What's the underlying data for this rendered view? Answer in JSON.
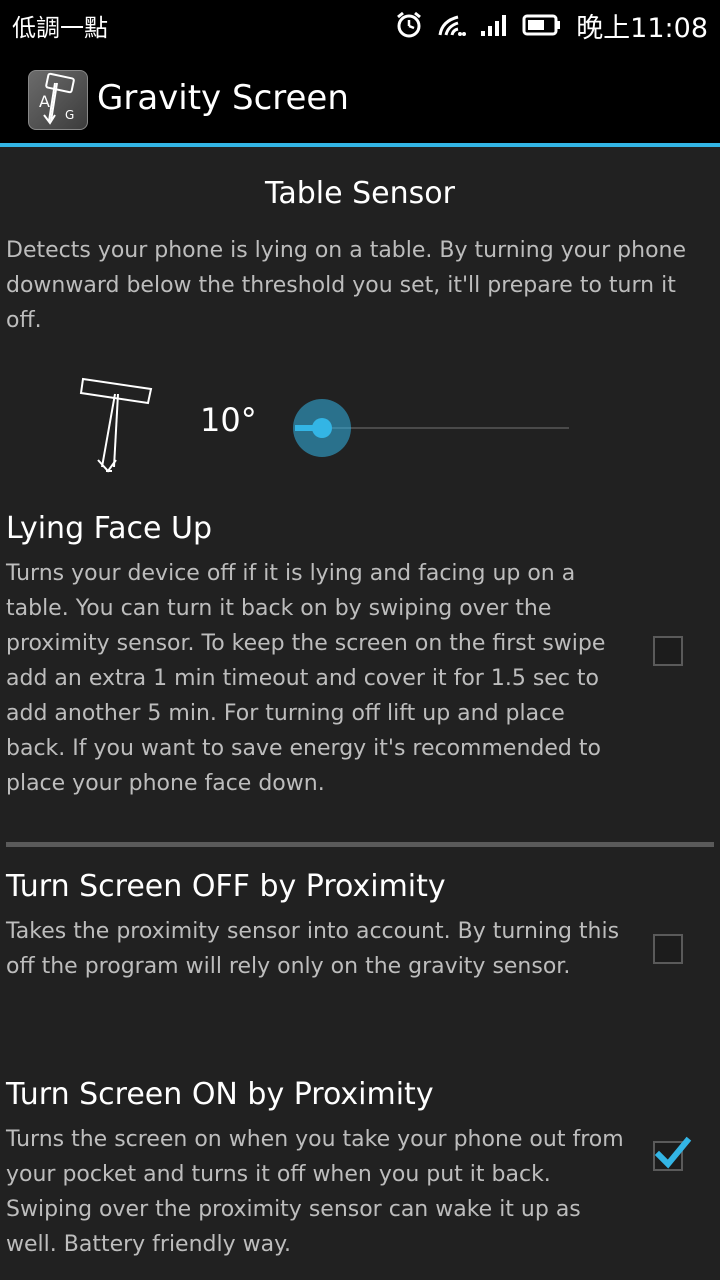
{
  "status_bar": {
    "carrier_text": "低調一點",
    "time": "晚上11:08",
    "icons": [
      "alarm-icon",
      "wifi-icon",
      "signal-icon",
      "battery-icon"
    ]
  },
  "action_bar": {
    "title": "Gravity Screen",
    "icon": "app-icon",
    "icon_letters": "AG"
  },
  "table_sensor": {
    "title": "Table Sensor",
    "description": "Detects your phone is lying on a table. By turning your phone downward below the threshold you set, it'll prepare to turn it off.",
    "angle_label": "10°",
    "slider_fraction": 0.1
  },
  "preferences": [
    {
      "title": "Lying Face Up",
      "summary": "Turns your device off if it is lying and facing up on a table. You can turn it back on by swiping over the proximity sensor. To keep the screen on the first swipe add an extra 1 min timeout and cover it for 1.5 sec to add another 5 min. For turning off lift up and place back. If you want to save energy it's recommended to place your phone face down.",
      "checked": false
    },
    {
      "title": "Turn Screen OFF by Proximity",
      "summary": "Takes the proximity sensor into account. By turning this off the program will rely only on the gravity sensor.",
      "checked": false
    },
    {
      "title": "Turn Screen ON by Proximity",
      "summary": "Turns the screen on when you take your phone out from your pocket and turns it off when you put it back. Swiping over the proximity sensor can wake it up as well. Battery friendly way.",
      "checked": true
    }
  ],
  "colors": {
    "accent": "#33b5e5",
    "background": "#212121",
    "bar": "#000000",
    "summary_text": "#bdbdbd"
  }
}
